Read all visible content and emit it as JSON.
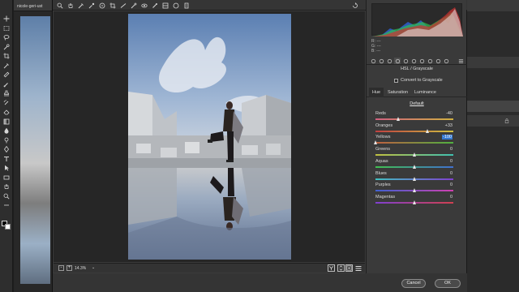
{
  "background_doc": {
    "tab_label": "nicole-geri-ust"
  },
  "tools": [
    "move-icon",
    "marquee-icon",
    "lasso-icon",
    "quick-select-icon",
    "crop-icon",
    "eyedropper-icon",
    "healing-icon",
    "brush-icon",
    "stamp-icon",
    "history-brush-icon",
    "eraser-icon",
    "gradient-icon",
    "blur-icon",
    "dodge-icon",
    "pen-icon",
    "type-icon",
    "path-select-icon",
    "rectangle-icon",
    "hand-icon",
    "zoom-icon",
    "more-icon"
  ],
  "acr_toolbar": [
    "zoom-icon",
    "hand-icon",
    "white-balance-icon",
    "color-sampler-icon",
    "target-adjust-icon",
    "crop-icon",
    "straighten-icon",
    "spot-removal-icon",
    "red-eye-icon",
    "adjustment-brush-icon",
    "graduated-filter-icon",
    "radial-filter-icon",
    "preferences-icon",
    "rotate-icon"
  ],
  "readout": {
    "r": "R:",
    "g": "G:",
    "b": "B:",
    "r_val": "---",
    "g_val": "---",
    "b_val": "---"
  },
  "panel": {
    "title": "HSL / Grayscale",
    "convert_label": "Convert to Grayscale",
    "convert_checked": false,
    "subtabs": [
      "Hue",
      "Saturation",
      "Luminance"
    ],
    "active_subtab": "Hue",
    "default_label": "Default",
    "sliders": [
      {
        "label": "Reds",
        "value": "-40",
        "pos": 0.3,
        "colors": [
          "#d06080",
          "#d0b040"
        ]
      },
      {
        "label": "Oranges",
        "value": "+33",
        "pos": 0.67,
        "colors": [
          "#c04040",
          "#d0c040"
        ]
      },
      {
        "label": "Yellows",
        "value": "-100",
        "pos": 0.0,
        "colors": [
          "#c06040",
          "#50b040"
        ],
        "selected": true
      },
      {
        "label": "Greens",
        "value": "0",
        "pos": 0.5,
        "colors": [
          "#c0c040",
          "#40c0b0"
        ]
      },
      {
        "label": "Aquas",
        "value": "0",
        "pos": 0.5,
        "colors": [
          "#40c050",
          "#4070d0"
        ]
      },
      {
        "label": "Blues",
        "value": "0",
        "pos": 0.5,
        "colors": [
          "#40c0c0",
          "#8040d0"
        ]
      },
      {
        "label": "Purples",
        "value": "0",
        "pos": 0.5,
        "colors": [
          "#4060d0",
          "#d040b0"
        ]
      },
      {
        "label": "Magentas",
        "value": "0",
        "pos": 0.5,
        "colors": [
          "#8040d0",
          "#d04050"
        ]
      }
    ]
  },
  "preview_footer": {
    "zoom_value": "14.3%",
    "zoom_minus": "-",
    "zoom_plus": "+",
    "zoom_caret": "⌄"
  },
  "buttons": {
    "cancel": "Cancel",
    "ok": "OK"
  }
}
